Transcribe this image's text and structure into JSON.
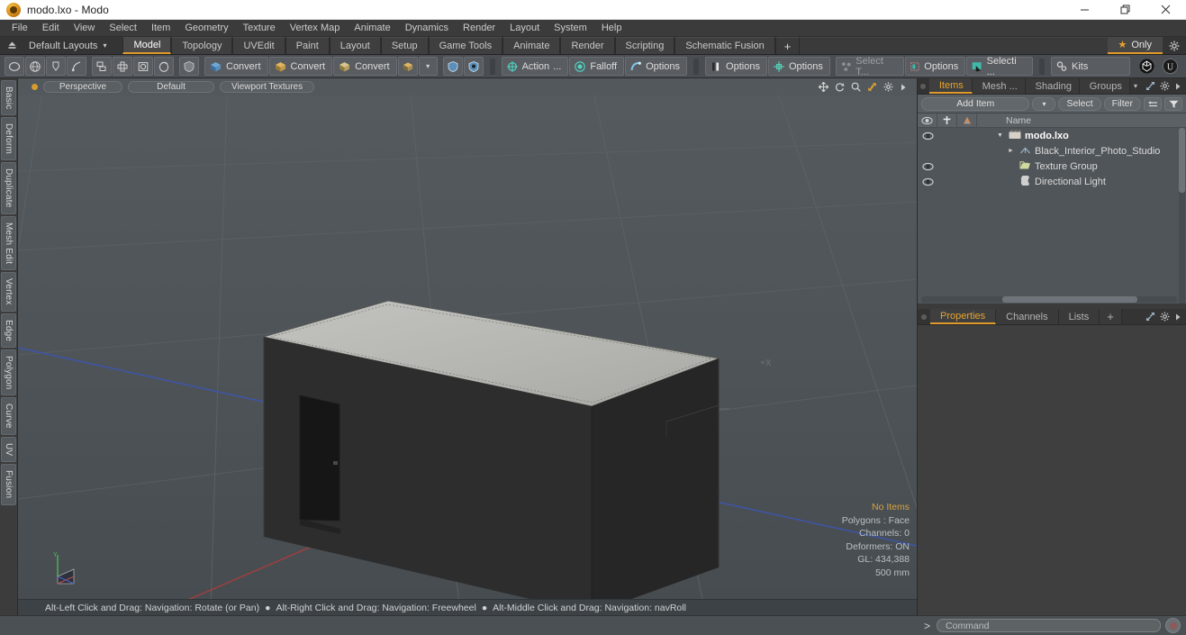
{
  "window": {
    "title": "modo.lxo - Modo",
    "app_icon": "modo-logo-icon",
    "controls": {
      "minimize": "minimize-icon",
      "maximize": "maximize-icon",
      "close": "close-icon"
    }
  },
  "menubar": {
    "items": [
      "File",
      "Edit",
      "View",
      "Select",
      "Item",
      "Geometry",
      "Texture",
      "Vertex Map",
      "Animate",
      "Dynamics",
      "Render",
      "Layout",
      "System",
      "Help"
    ]
  },
  "layoutbar": {
    "home_icon": "home-up-icon",
    "layout_select": "Default Layouts",
    "caret": "▾",
    "tabs": [
      {
        "label": "Model",
        "active": true
      },
      {
        "label": "Topology",
        "active": false
      },
      {
        "label": "UVEdit",
        "active": false
      },
      {
        "label": "Paint",
        "active": false
      },
      {
        "label": "Layout",
        "active": false
      },
      {
        "label": "Setup",
        "active": false
      },
      {
        "label": "Game Tools",
        "active": false
      },
      {
        "label": "Animate",
        "active": false
      },
      {
        "label": "Render",
        "active": false
      },
      {
        "label": "Scripting",
        "active": false
      },
      {
        "label": "Schematic Fusion",
        "active": false
      }
    ],
    "add_tab": "+",
    "only_button": {
      "label": "Only",
      "star": "★"
    },
    "gear_icon": "gear-icon"
  },
  "toolbar": {
    "groups": [
      {
        "items": [
          {
            "name": "circle-tool",
            "icon": "circle-icon"
          },
          {
            "name": "sphere-tool",
            "icon": "globe-icon"
          },
          {
            "name": "pen-tool",
            "icon": "pen-icon"
          },
          {
            "name": "curve-tool",
            "icon": "curve-icon"
          }
        ]
      },
      {
        "items": [
          {
            "name": "copy-tool",
            "icon": "copy-icon"
          },
          {
            "name": "array-tool",
            "icon": "plus-box-icon"
          },
          {
            "name": "bool-tool",
            "icon": "square-circle-icon"
          },
          {
            "name": "drop-tool",
            "icon": "drop-icon"
          }
        ]
      },
      {
        "items": [
          {
            "name": "shield-tool",
            "icon": "shield-icon"
          }
        ]
      },
      {
        "items": [
          {
            "name": "convert-1",
            "label": "Convert",
            "icon": "mesh-blue-icon"
          },
          {
            "name": "convert-2",
            "label": "Convert",
            "icon": "mesh-yellow-icon"
          },
          {
            "name": "convert-3",
            "label": "Convert",
            "icon": "mesh-box-icon"
          },
          {
            "name": "convert-4",
            "icon": "mesh-small-icon"
          },
          {
            "name": "convert-dropdown",
            "icon": "chevron-down-icon"
          }
        ]
      },
      {
        "items": [
          {
            "name": "shield-blue-1",
            "icon": "shield-blue-icon"
          },
          {
            "name": "shield-blue-2",
            "icon": "shield-dot-icon"
          }
        ]
      },
      {
        "items": [
          {
            "name": "action-center",
            "label": "Action",
            "sub": "...",
            "icon": "target-icon"
          },
          {
            "name": "falloff",
            "label": "Falloff",
            "icon": "falloff-icon"
          },
          {
            "name": "options-snap",
            "label": "Options",
            "icon": "snap-icon"
          }
        ]
      },
      {
        "items": [
          {
            "name": "options-symmetry",
            "label": "Options",
            "icon": "symmetry-icon"
          },
          {
            "name": "options-workplane",
            "label": "Options",
            "icon": "workplane-icon"
          }
        ]
      },
      {
        "items": [
          {
            "name": "select-through",
            "label": "Select T...",
            "icon": "select-through-icon",
            "dim": true
          },
          {
            "name": "options-element",
            "label": "Options",
            "icon": "element-icon"
          },
          {
            "name": "selection-set",
            "label": "Selecti ...",
            "icon": "selection-icon"
          }
        ]
      },
      {
        "items": [
          {
            "name": "kits",
            "label": "Kits",
            "icon": "kits-gear-icon"
          }
        ]
      },
      {
        "items": [
          {
            "name": "preview-render",
            "icon": "sphere-black-icon"
          },
          {
            "name": "unreal-bridge",
            "icon": "unreal-icon"
          }
        ]
      }
    ]
  },
  "leftrail": {
    "tabs": [
      "Basic",
      "Deform",
      "Duplicate",
      "Mesh Edit",
      "Vertex",
      "Edge",
      "Polygon",
      "Curve",
      "UV",
      "Fusion"
    ]
  },
  "viewport": {
    "header": {
      "dot": "viewport-indicator",
      "chips": [
        "Perspective",
        "Default",
        "Viewport Textures"
      ],
      "icons": [
        "pan-icon",
        "rotate-icon",
        "zoom-icon",
        "fit-icon",
        "gear-icon",
        "chevron-right-icon"
      ]
    },
    "axis_label": "+X",
    "stats": {
      "selection": "No Items",
      "polygons": "Polygons : Face",
      "channels": "Channels: 0",
      "deformers": "Deformers: ON",
      "gl": "GL: 434,388",
      "scale": "500 mm"
    },
    "gizmo": {
      "y_label": "Y"
    },
    "colors": {
      "background": "#4e5458",
      "grid": "#5b6165",
      "x_axis": "#a85050",
      "z_axis": "#4a5fa8",
      "model_wall": "#2a2a2a",
      "model_top": "#b9b9b5"
    }
  },
  "statusbar": {
    "hints": [
      "Alt-Left Click and Drag: Navigation: Rotate (or Pan)",
      "Alt-Right Click and Drag: Navigation: Freewheel",
      "Alt-Middle Click and Drag: Navigation: navRoll"
    ],
    "separator": "●"
  },
  "rightpanel": {
    "top_tabs": [
      {
        "label": "Items",
        "active": true
      },
      {
        "label": "Mesh ...",
        "active": false
      },
      {
        "label": "Shading",
        "active": false
      },
      {
        "label": "Groups",
        "active": false
      }
    ],
    "top_tab_icons": [
      "chevron-down-icon",
      "expand-icon",
      "gear-icon",
      "chevron-right-icon"
    ],
    "items_toolbar": {
      "add_item": "Add Item",
      "add_item_arrow": "▾",
      "select": "Select",
      "filter": "Filter",
      "icons": [
        "swap-icon",
        "funnel-icon"
      ]
    },
    "items_list": {
      "columns": [
        "eye-icon",
        "lock-icon",
        "render-icon",
        "Name"
      ],
      "rows": [
        {
          "name": "modo.lxo",
          "icon": "scene-icon",
          "depth": 0,
          "eye": true,
          "expanded": true,
          "bold": true
        },
        {
          "name": "Black_Interior_Photo_Studio",
          "icon": "mesh-item-icon",
          "depth": 1,
          "eye": false,
          "has_children": true
        },
        {
          "name": "Texture Group",
          "icon": "folder-icon",
          "depth": 1,
          "eye": true
        },
        {
          "name": "Directional Light",
          "icon": "light-icon",
          "depth": 1,
          "eye": true
        }
      ]
    },
    "bottom_tabs": [
      {
        "label": "Properties",
        "active": true
      },
      {
        "label": "Channels",
        "active": false
      },
      {
        "label": "Lists",
        "active": false
      },
      {
        "label": "+",
        "active": false
      }
    ],
    "bottom_tab_icons": [
      "expand-icon",
      "gear-icon",
      "chevron-right-icon"
    ]
  },
  "commandbar": {
    "prompt": ">",
    "placeholder": "Command",
    "record_icon": "record-icon"
  },
  "theme": {
    "accent": "#e09a2b",
    "panel_bg": "#3b3b3b",
    "toolbar_bg": "#4a4e52",
    "viewport_bg": "#4e5458"
  }
}
